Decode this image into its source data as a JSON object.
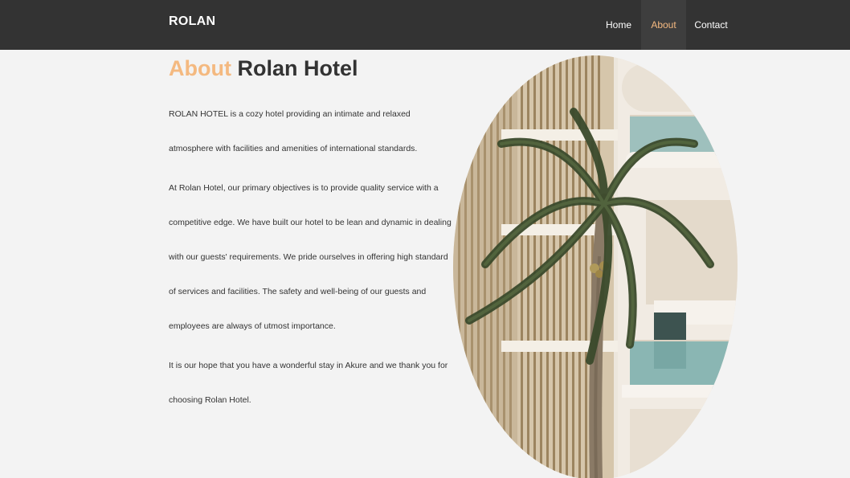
{
  "navbar": {
    "brand": "ROLAN",
    "items": [
      {
        "label": "Home",
        "active": false
      },
      {
        "label": "About",
        "active": true
      },
      {
        "label": "Contact",
        "active": false
      }
    ]
  },
  "heading": {
    "accent": "About",
    "rest": "Rolan Hotel"
  },
  "paragraphs": [
    "ROLAN HOTEL is a cozy hotel providing an intimate and relaxed atmosphere with facilities and amenities of international standards.",
    "At Rolan Hotel, our primary objectives is to provide quality service with a competitive edge. We have built our hotel to be lean and dynamic in dealing with our guests' requirements. We pride ourselves in offering high standard of services and facilities. The safety and well-being of our guests and employees are always of utmost importance.",
    "It is our hope that you have a wonderful stay in Akure and we thank you for choosing Rolan Hotel."
  ],
  "colors": {
    "navbar_bg": "#333333",
    "accent": "#f4b980",
    "page_bg": "#f3f3f3",
    "text": "#333333"
  },
  "image": {
    "subject": "hotel-building-with-palm-tree-photo"
  }
}
